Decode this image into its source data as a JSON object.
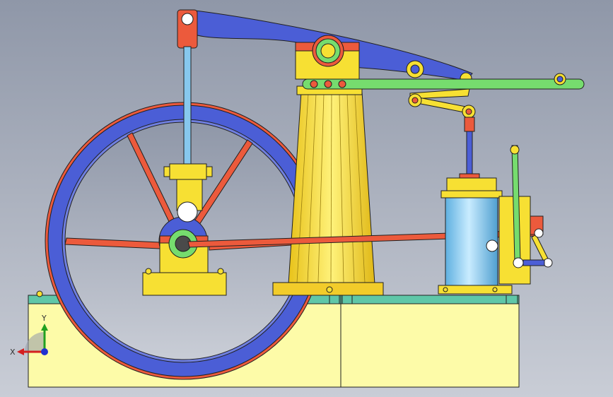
{
  "viewport": {
    "background_top": "#8f97a8",
    "background_bottom": "#c9cdd6"
  },
  "colors": {
    "base": "#fdfba8",
    "base_top": "#5fc7a8",
    "beam": "#4b5ed6",
    "column": "#f7e033",
    "rod_red": "#ec5a3c",
    "rod_blue": "#87c8ee",
    "link_green": "#76dc6e",
    "cylinder": "#7fc9f0",
    "flywheel": "#4b5ed6",
    "outline": "#202020"
  },
  "triad": {
    "x_label": "X",
    "y_label": "Y",
    "x_color": "#d42020",
    "y_color": "#20a020",
    "z_color": "#2030d0"
  },
  "icons": {
    "coordinate_triad": "xyz-axis-icon"
  }
}
